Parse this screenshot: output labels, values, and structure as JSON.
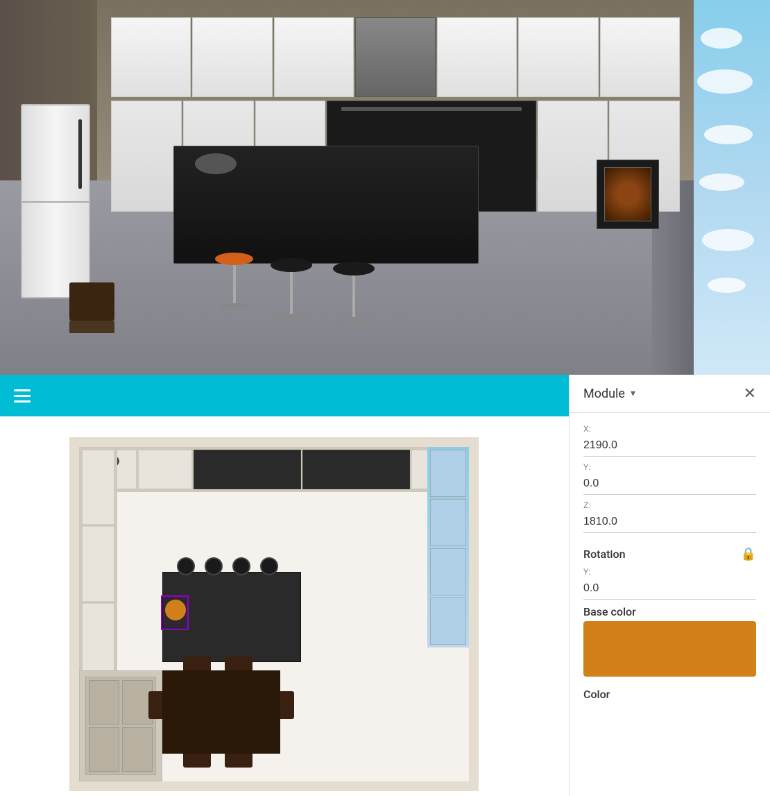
{
  "top_view": {
    "alt": "3D kitchen render - perspective view"
  },
  "toolbar": {
    "menu_icon": "≡",
    "background_color": "#00BCD4"
  },
  "right_panel": {
    "title": "Module",
    "close_label": "✕",
    "dropdown_arrow": "▾",
    "position": {
      "x_label": "X:",
      "x_value": "2190.0",
      "y_label": "Y:",
      "y_value": "0.0",
      "z_label": "Z:",
      "z_value": "1810.0"
    },
    "rotation": {
      "section_title": "Rotation",
      "lock_icon": "🔒",
      "y_label": "Y:",
      "y_value": "0.0"
    },
    "base_color": {
      "section_title": "Base color",
      "color": "#D2801A"
    },
    "color": {
      "section_title": "Color"
    }
  },
  "bottom_view": {
    "alt": "2D top-down kitchen view"
  }
}
